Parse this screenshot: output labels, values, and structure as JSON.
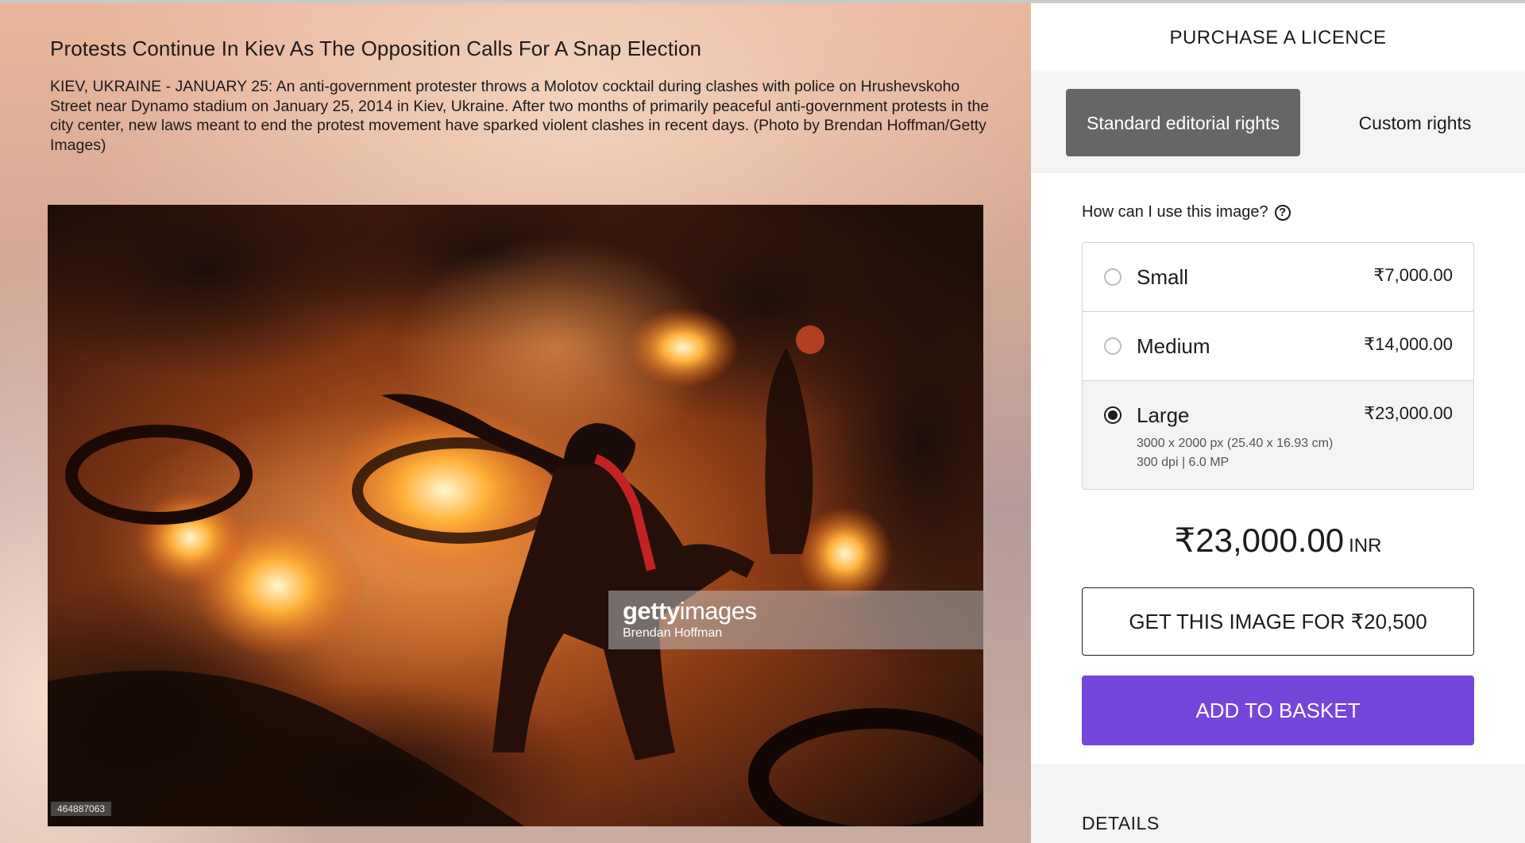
{
  "image": {
    "title": "Protests Continue In Kiev As The Opposition Calls For A Snap Election",
    "caption": "KIEV, UKRAINE - JANUARY 25: An anti-government protester throws a Molotov cocktail during clashes with police on Hrushevskoho Street near Dynamo stadium on January 25, 2014 in Kiev, Ukraine. After two months of primarily peaceful anti-government protests in the city center, new laws meant to end the protest movement have sparked violent clashes in recent days. (Photo by Brendan Hoffman/Getty Images)",
    "watermark_brand_bold": "getty",
    "watermark_brand_rest": "images",
    "watermark_credit": "Brendan Hoffman",
    "image_id": "464887063"
  },
  "licence": {
    "heading": "PURCHASE A LICENCE",
    "tabs": [
      {
        "label": "Standard editorial rights",
        "active": true
      },
      {
        "label": "Custom rights",
        "active": false
      }
    ],
    "usage_question": "How can I use this image?",
    "help_icon": "question-circle-icon",
    "options": [
      {
        "label": "Small",
        "price": "₹7,000.00",
        "selected": false
      },
      {
        "label": "Medium",
        "price": "₹14,000.00",
        "selected": false
      },
      {
        "label": "Large",
        "price": "₹23,000.00",
        "selected": true,
        "detail_line1": "3000 x 2000 px (25.40 x 16.93 cm)",
        "detail_line2": "300 dpi | 6.0 MP"
      }
    ],
    "total_amount": "₹23,000.00",
    "total_currency": "INR",
    "offer_button": "GET THIS IMAGE FOR ₹20,500",
    "basket_button": "ADD TO BASKET",
    "details_heading": "DETAILS"
  },
  "colors": {
    "accent": "#7446db",
    "active_tab": "#666666",
    "panel_gray": "#f4f4f4"
  }
}
